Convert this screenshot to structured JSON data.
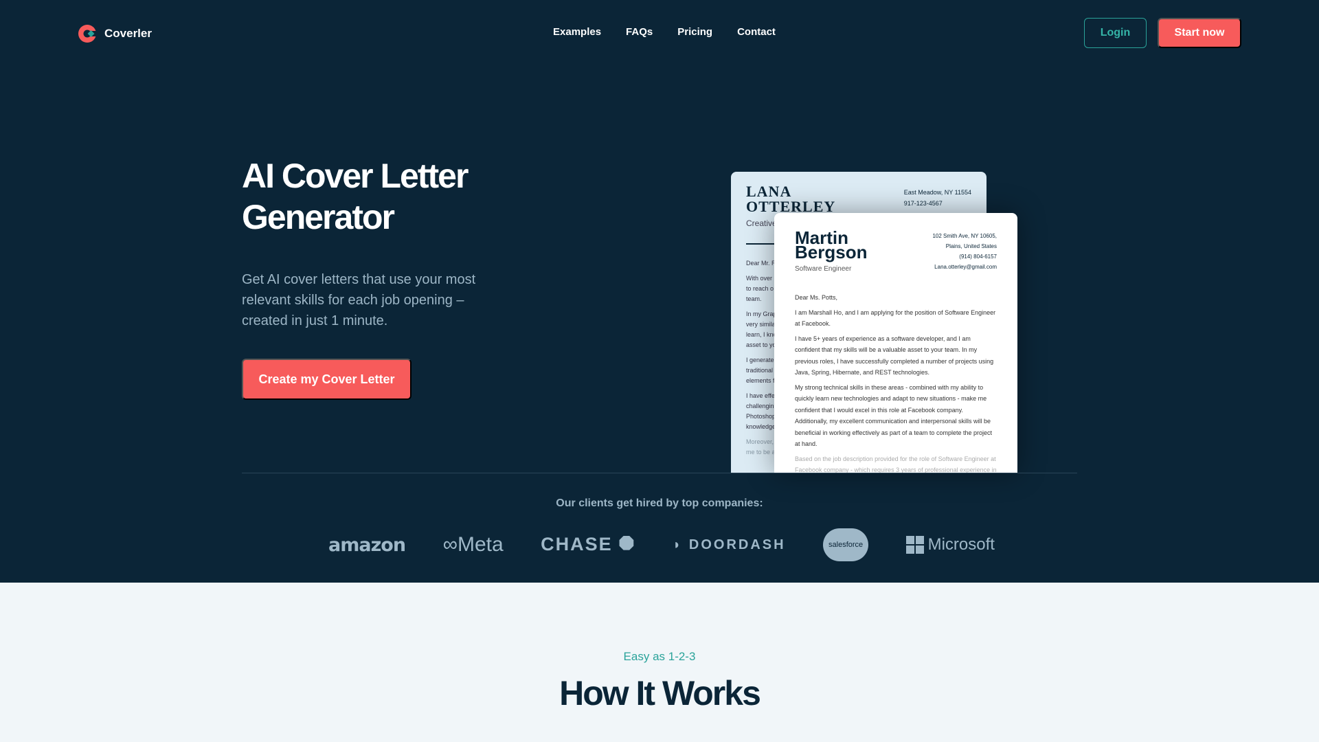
{
  "brand": {
    "name": "Coverler",
    "accent": "#f75b5b",
    "teal": "#2aa39a",
    "bg": "#0b2537"
  },
  "nav": {
    "items": [
      "Examples",
      "FAQs",
      "Pricing",
      "Contact"
    ],
    "login": "Login",
    "start": "Start now"
  },
  "hero": {
    "title": "AI Cover Letter Generator",
    "subtitle": "Get AI cover letters that use your most relevant skills for each job opening – created in just 1 minute.",
    "cta": "Create my Cover Letter"
  },
  "card_back": {
    "name_line1": "LANA",
    "name_line2": "OTTERLEY",
    "role": "Creative",
    "address": "East Meadow, NY 11554",
    "phone": "917-123-4567",
    "lines": [
      "Dear Mr. R",
      "With over",
      "to reach o",
      "team.",
      "In my Grap",
      "very simila",
      "learn, I kno",
      "asset to yo",
      "I generate",
      "traditional",
      "elements f",
      "I have effe",
      "challengin",
      "Photoshop",
      "knowledge",
      "Moreover,",
      "me to be a"
    ]
  },
  "card_front": {
    "name_line1": "Martin",
    "name_line2": "Bergson",
    "role": "Software Engineer",
    "address1": "102 Smith Ave, NY 10605,",
    "address2": "Plains, United States",
    "phone": "(914) 804-6157",
    "email": "Lana.otterley@gmail.com",
    "greeting": "Dear Ms. Potts,",
    "paragraphs": [
      "I am Marshall Ho, and I am applying for the position of Software Engineer at Facebook.",
      "I have 5+ years of experience as a software developer, and I am confident that my skills will be a valuable asset to your team. In my previous roles, I have successfully completed a number of projects using Java, Spring, Hibernate, and REST technologies.",
      "My strong technical skills in these areas - combined with my ability to quickly learn new technologies and adapt to new situations - make me confident that I would excel in this role at Facebook company. Additionally, my excellent communication and interpersonal skills will be beneficial in working effectively as part of a team to complete the project at hand.",
      "Based on the job description provided for the role of Software Engineer at Facebook company - which requires 3 years of professional experience in"
    ]
  },
  "clients": {
    "heading": "Our clients get hired by top companies:",
    "logos": [
      "amazon",
      "Meta",
      "CHASE",
      "DOORDASH",
      "salesforce",
      "Microsoft"
    ]
  },
  "how": {
    "eyebrow": "Easy as 1-2-3",
    "title": "How It Works"
  }
}
